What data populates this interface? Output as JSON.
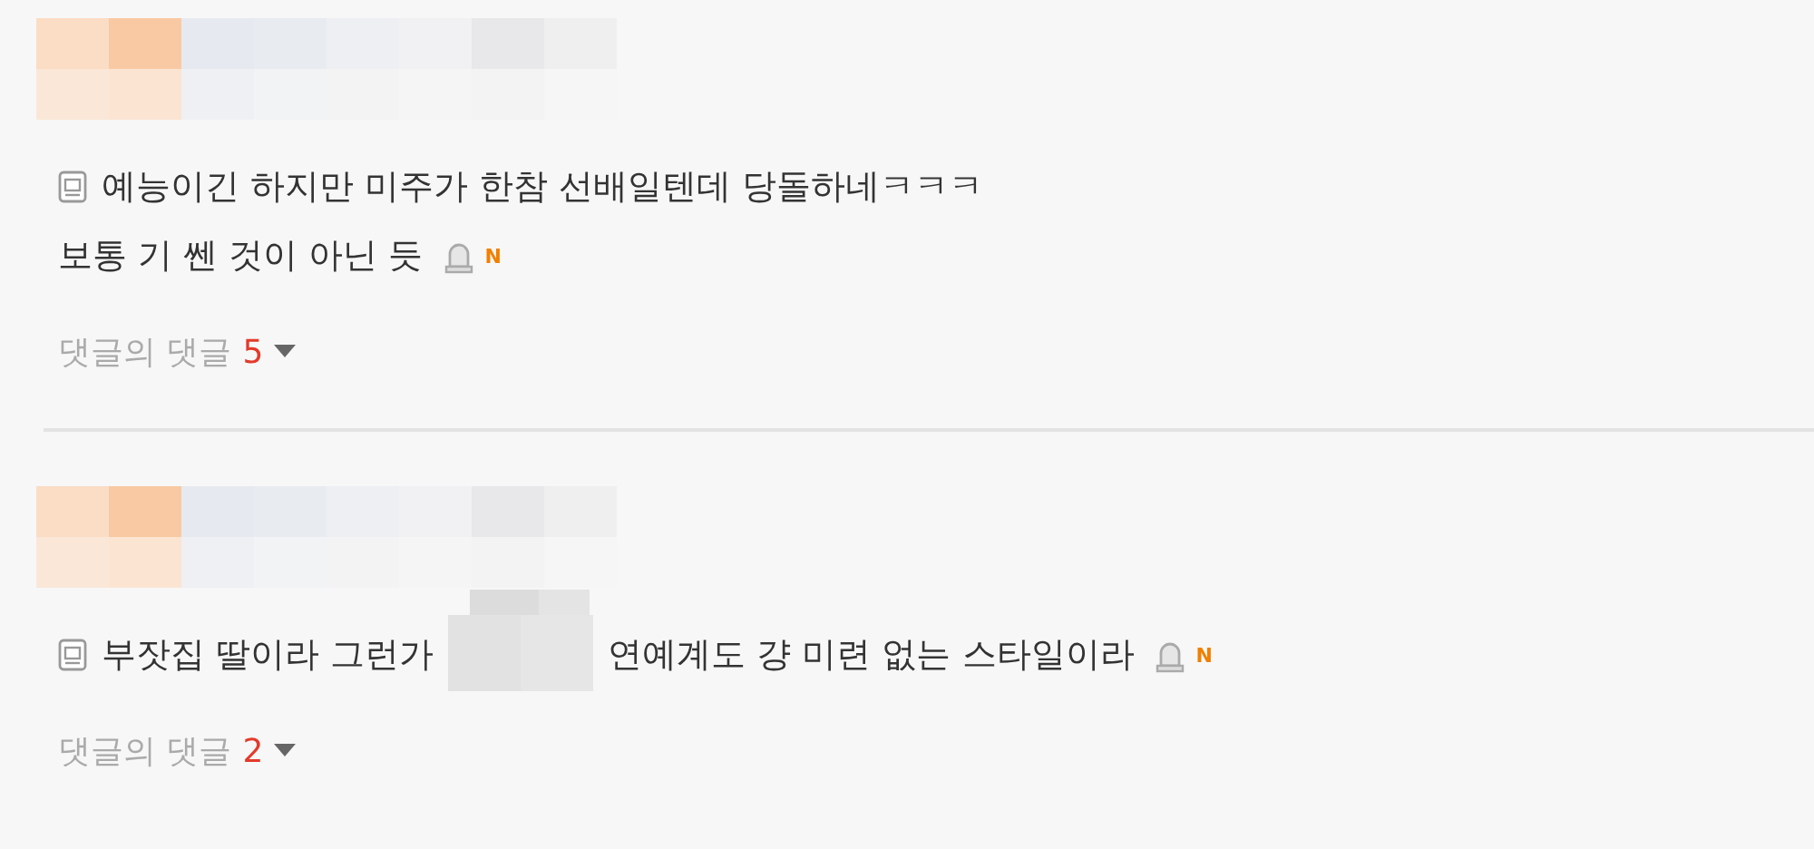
{
  "comments": [
    {
      "lines": [
        [
          {
            "kind": "text",
            "text": "예능이긴 하지만 미주가 한참 선배일텐데 당돌하네ㅋㅋㅋ"
          }
        ],
        [
          {
            "kind": "text",
            "text": "보통 기 쎈 것이 아닌 듯"
          }
        ]
      ],
      "new_badge": "N",
      "replies_label": "댓글의 댓글",
      "replies_count": "5"
    },
    {
      "lines": [
        [
          {
            "kind": "text",
            "text": "부잣집 딸이라 그런가"
          },
          {
            "kind": "redacted"
          },
          {
            "kind": "text",
            "text": "연예계도 걍 미련 없는 스타일이라"
          }
        ]
      ],
      "new_badge": "N",
      "replies_label": "댓글의 댓글",
      "replies_count": "2"
    }
  ]
}
